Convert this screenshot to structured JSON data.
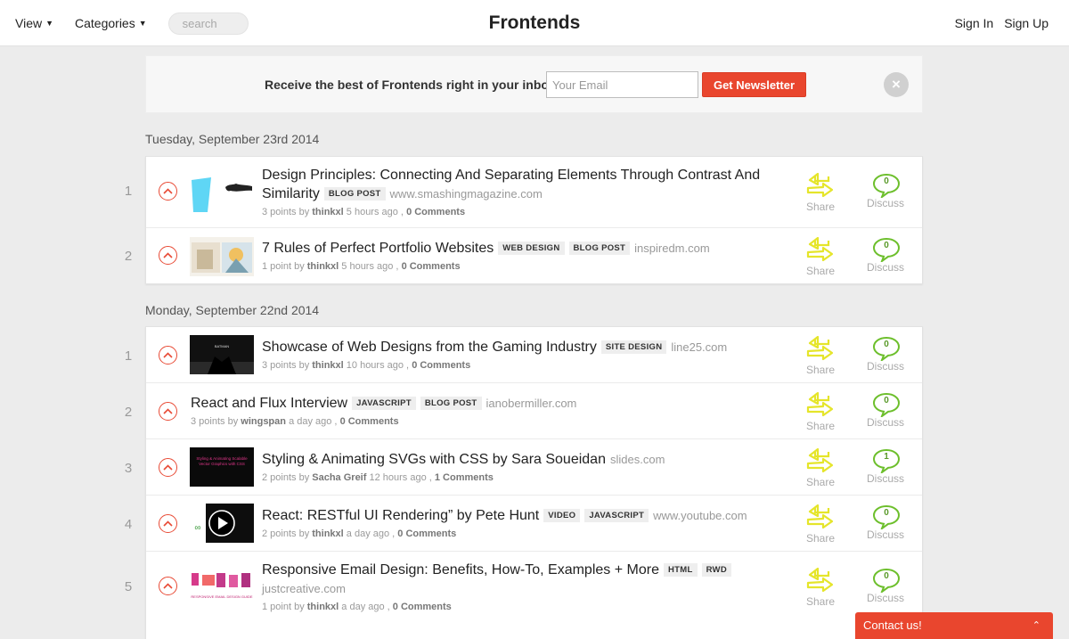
{
  "header": {
    "view_label": "View",
    "categories_label": "Categories",
    "search_placeholder": "search",
    "brand": "Frontends",
    "sign_in": "Sign In",
    "sign_up": "Sign Up"
  },
  "newsletter": {
    "text": "Receive the best of Frontends right in your inbox",
    "email_placeholder": "Your Email",
    "button": "Get Newsletter",
    "close": "×"
  },
  "actions": {
    "share_label": "Share",
    "discuss_label": "Discuss"
  },
  "days": [
    {
      "heading": "Tuesday, September 23rd 2014",
      "posts": [
        {
          "rank": "1",
          "thumbnail": "design-principles-thumb",
          "title": "Design Principles: Connecting And Separating Elements Through Contrast And Similarity",
          "tags": [
            "BLOG POST"
          ],
          "domain": "www.smashingmagazine.com",
          "points": "3 points by",
          "author": "thinkxl",
          "time": "5 hours ago ,",
          "comments": "0 Comments",
          "discuss_count": "0"
        },
        {
          "rank": "2",
          "thumbnail": "portfolio-thumb",
          "title": "7 Rules of Perfect Portfolio Websites",
          "tags": [
            "WEB DESIGN",
            "BLOG POST"
          ],
          "domain": "inspiredm.com",
          "points": "1 point by",
          "author": "thinkxl",
          "time": "5 hours ago ,",
          "comments": "0 Comments",
          "discuss_count": "0"
        }
      ]
    },
    {
      "heading": "Monday, September 22nd 2014",
      "posts": [
        {
          "rank": "1",
          "thumbnail": "gaming-thumb",
          "title": "Showcase of Web Designs from the Gaming Industry",
          "tags": [
            "SITE DESIGN"
          ],
          "domain": "line25.com",
          "points": "3 points by",
          "author": "thinkxl",
          "time": "10 hours ago ,",
          "comments": "0 Comments",
          "discuss_count": "0"
        },
        {
          "rank": "2",
          "thumbnail": "",
          "title": "React and Flux Interview",
          "tags": [
            "JAVASCRIPT",
            "BLOG POST"
          ],
          "domain": "ianobermiller.com",
          "points": "3 points by",
          "author": "wingspan",
          "time": "a day ago ,",
          "comments": "0 Comments",
          "discuss_count": "0"
        },
        {
          "rank": "3",
          "thumbnail": "svg-slides-thumb",
          "title": "Styling & Animating SVGs with CSS by Sara Soueidan",
          "tags": [],
          "domain": "slides.com",
          "points": "2 points by",
          "author": "Sacha Greif",
          "time": "12 hours ago ,",
          "comments": "1 Comments",
          "discuss_count": "1"
        },
        {
          "rank": "4",
          "thumbnail": "video-thumb",
          "title": "React: RESTful UI Rendering” by Pete Hunt",
          "tags": [
            "VIDEO",
            "JAVASCRIPT"
          ],
          "domain": "www.youtube.com",
          "points": "2 points by",
          "author": "thinkxl",
          "time": "a day ago ,",
          "comments": "0 Comments",
          "discuss_count": "0"
        },
        {
          "rank": "5",
          "thumbnail": "email-design-thumb",
          "title": "Responsive Email Design: Benefits, How-To, Examples + More",
          "tags": [
            "HTML",
            "RWD"
          ],
          "domain": "justcreative.com",
          "points": "1 point by",
          "author": "thinkxl",
          "time": "a day ago ,",
          "comments": "0 Comments",
          "discuss_count": "0"
        }
      ]
    }
  ],
  "thumb_text": {
    "gaming": "BATMAN",
    "svg_slides": "Styling & Animating Scalable Vector Graphics with CSS",
    "email_design": "RESPONSIVE EMAIL DESIGN GUIDE"
  },
  "contact": {
    "label": "Contact us!",
    "chevron": "⌃"
  },
  "colors": {
    "accent": "#e9462e",
    "share_yellow": "#e8e82a",
    "discuss_green": "#6dbf2c"
  }
}
